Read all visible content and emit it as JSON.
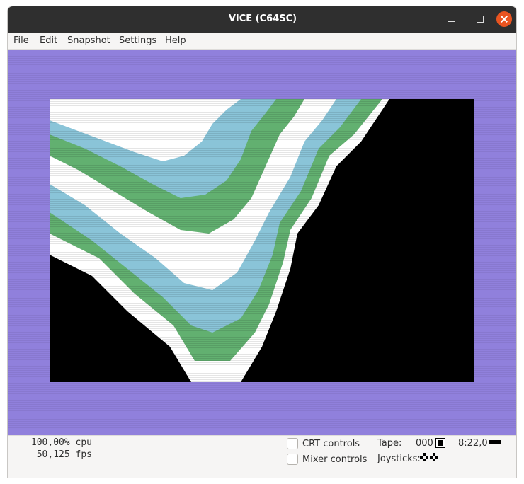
{
  "window": {
    "title": "VICE (C64SC)"
  },
  "menu": {
    "items": [
      "File",
      "Edit",
      "Snapshot",
      "Settings",
      "Help"
    ]
  },
  "emulator": {
    "border_color": "#9080dc",
    "background": "#000000",
    "palette": [
      "#ffffff",
      "#8ac4d8",
      "#62b070",
      "#000000"
    ]
  },
  "status": {
    "cpu": "100,00% cpu",
    "fps": "50,125 fps",
    "crt_controls": "CRT controls",
    "mixer_controls": "Mixer controls",
    "tape_label": "Tape:",
    "tape_counter": "000",
    "drive": "8:22,0",
    "joysticks_label": "Joysticks:"
  }
}
